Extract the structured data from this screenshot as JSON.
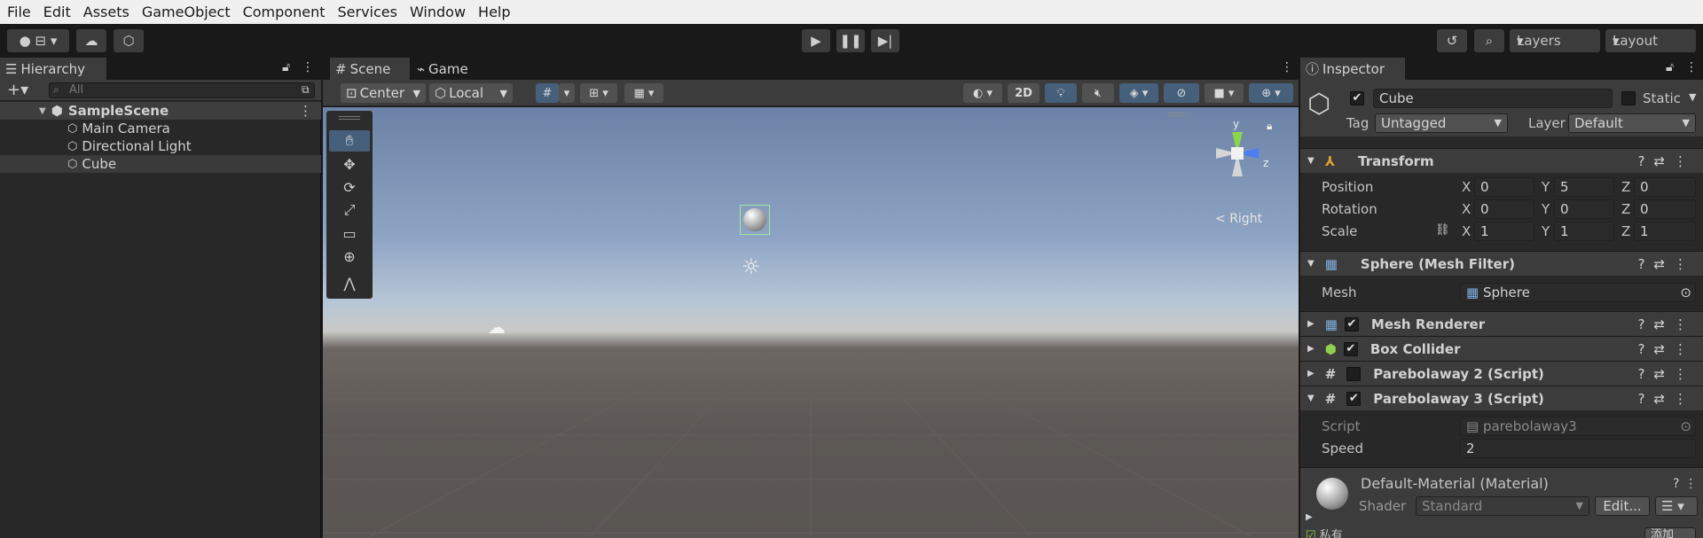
{
  "menu": [
    "File",
    "Edit",
    "Assets",
    "GameObject",
    "Component",
    "Services",
    "Window",
    "Help"
  ],
  "toolbar": {
    "account_icon": "account-icon",
    "cloud_icon": "cloud-icon",
    "collab_icon": "collab-icon",
    "play_icon": "play-icon",
    "pause_icon": "pause-icon",
    "step_icon": "step-icon",
    "history_icon": "history-icon",
    "search_icon": "search-icon",
    "layers_label": "Layers",
    "layout_label": "Layout"
  },
  "hierarchy": {
    "tab_label": "Hierarchy",
    "search_placeholder": "All",
    "scene_name": "SampleScene",
    "items": [
      "Main Camera",
      "Directional Light",
      "Cube"
    ]
  },
  "scene": {
    "tabs": [
      "Scene",
      "Game"
    ],
    "pivot_label": "Center",
    "space_label": "Local",
    "mode_2d_label": "2D",
    "gizmo_axes": {
      "y": "y",
      "z": "z"
    },
    "view_label": "Right"
  },
  "inspector": {
    "tab_label": "Inspector",
    "object_name": "Cube",
    "static_label": "Static",
    "tag_label": "Tag",
    "tag_value": "Untagged",
    "layer_label": "Layer",
    "layer_value": "Default",
    "transform": {
      "title": "Transform",
      "position_label": "Position",
      "rotation_label": "Rotation",
      "scale_label": "Scale",
      "axis_x": "X",
      "axis_y": "Y",
      "axis_z": "Z",
      "position": [
        "0",
        "5",
        "0"
      ],
      "rotation": [
        "0",
        "0",
        "0"
      ],
      "scale": [
        "1",
        "1",
        "1"
      ]
    },
    "mesh_filter": {
      "title": "Sphere (Mesh Filter)",
      "mesh_label": "Mesh",
      "mesh_value": "Sphere"
    },
    "mesh_renderer": {
      "title": "Mesh Renderer"
    },
    "box_collider": {
      "title": "Box Collider"
    },
    "script2": {
      "title": "Parebolaway 2 (Script)"
    },
    "script3": {
      "title": "Parebolaway 3 (Script)",
      "script_label": "Script",
      "script_value": "parebolaway3",
      "speed_label": "Speed",
      "speed_value": "2"
    },
    "material": {
      "title": "Default-Material (Material)",
      "shader_label": "Shader",
      "shader_value": "Standard",
      "edit_label": "Edit...",
      "private_label": "私有",
      "add_label": "添加"
    }
  }
}
